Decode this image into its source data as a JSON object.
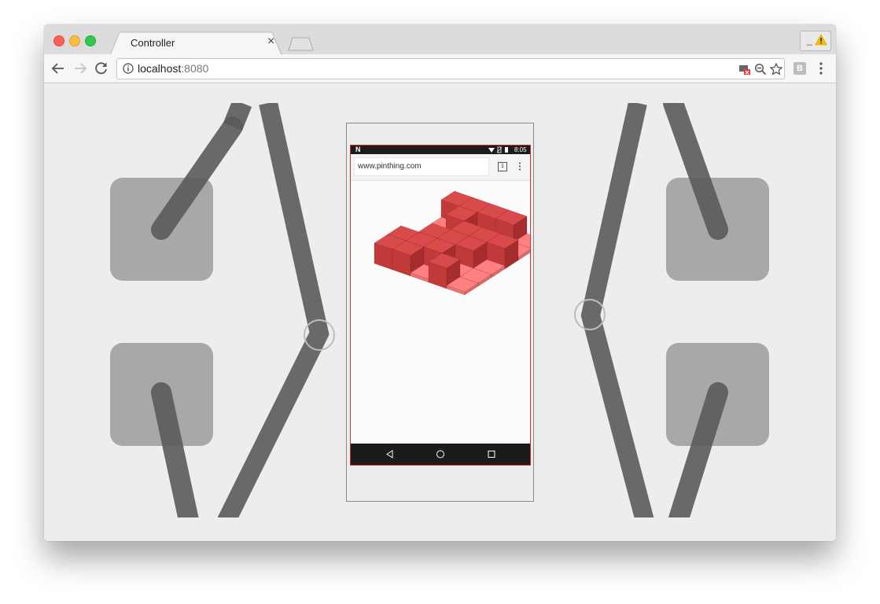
{
  "browser": {
    "tab_title": "Controller",
    "tab_close": "×",
    "url_host": "localhost",
    "url_port": ":8080"
  },
  "extension": {
    "label": "B"
  },
  "phone": {
    "status_time": "8:05",
    "status_logo": "N",
    "url": "www.pinthing.com",
    "tab_count": "1"
  },
  "colors": {
    "pin_dark": "#d94b4b",
    "pin_light": "#ff8080",
    "stick": "#666666",
    "pad": "#a8a8a8"
  }
}
